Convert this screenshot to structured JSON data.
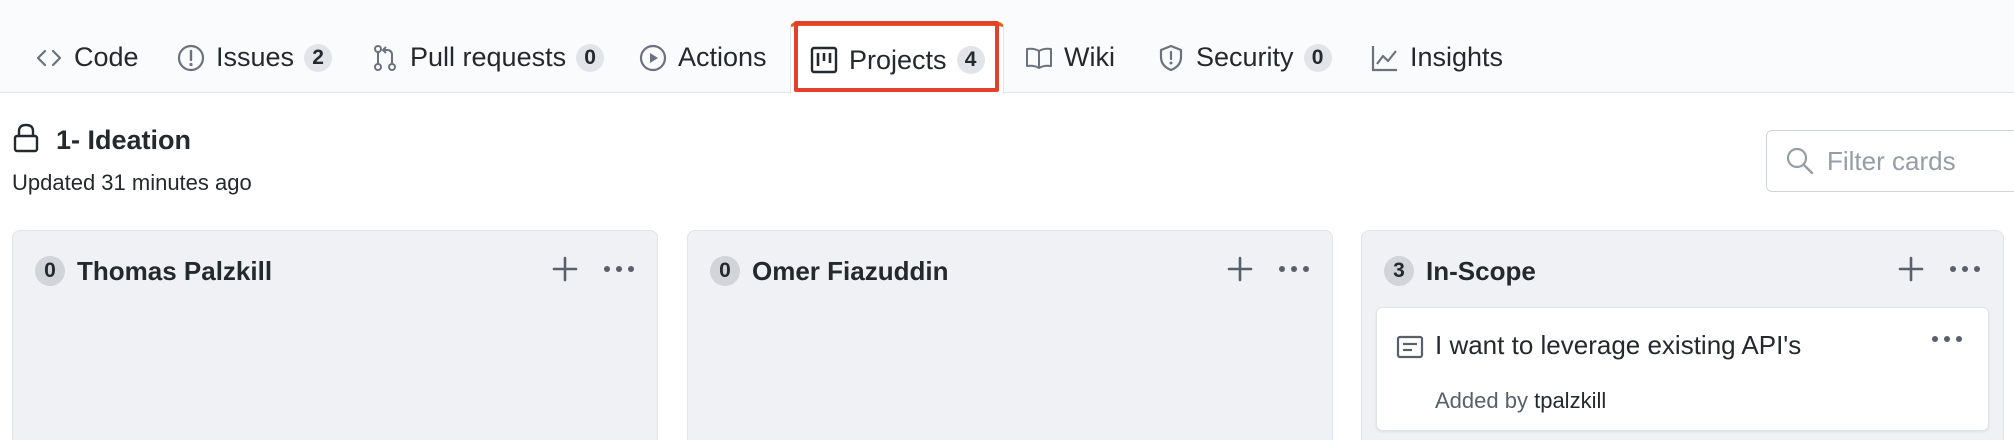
{
  "nav": {
    "tabs": [
      {
        "label": "Code",
        "icon": "code-icon"
      },
      {
        "label": "Issues",
        "count": "2",
        "icon": "issue-opened-icon"
      },
      {
        "label": "Pull requests",
        "count": "0",
        "icon": "git-pull-request-icon"
      },
      {
        "label": "Actions",
        "icon": "play-icon"
      },
      {
        "label": "Projects",
        "count": "4",
        "icon": "project-icon",
        "selected": true
      },
      {
        "label": "Wiki",
        "icon": "book-icon"
      },
      {
        "label": "Security",
        "count": "0",
        "icon": "shield-icon"
      },
      {
        "label": "Insights",
        "icon": "graph-icon"
      }
    ],
    "selected_accent": "#e36209",
    "highlight_color": "#e2412d"
  },
  "project": {
    "title": "1- Ideation",
    "updated": "Updated 31 minutes ago",
    "visibility_icon": "lock-icon"
  },
  "filter": {
    "placeholder": "Filter cards"
  },
  "columns": [
    {
      "count": "0",
      "name": "Thomas Palzkill",
      "cards": []
    },
    {
      "count": "0",
      "name": "Omer Fiazuddin",
      "cards": []
    },
    {
      "count": "3",
      "name": "In-Scope",
      "cards": [
        {
          "title": "I want to leverage existing API's",
          "added_prefix": "Added by",
          "author": "tpalzkill"
        }
      ]
    }
  ]
}
